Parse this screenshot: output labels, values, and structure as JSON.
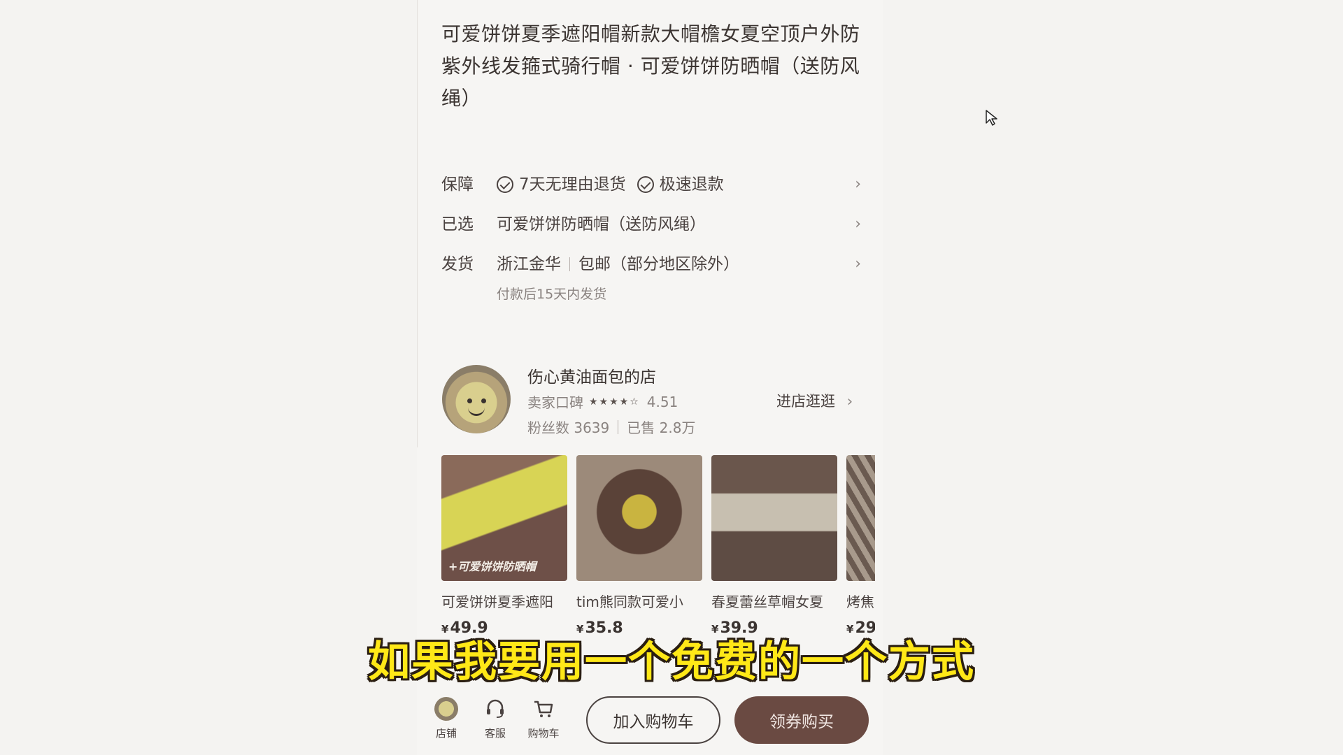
{
  "product": {
    "title": "可爱饼饼夏季遮阳帽新款大帽檐女夏空顶户外防紫外线发箍式骑行帽 · 可爱饼饼防晒帽（送防风绳）"
  },
  "info_rows": {
    "guarantee": {
      "label": "保障",
      "items": [
        "7天无理由退货",
        "极速退款"
      ]
    },
    "selected": {
      "label": "已选",
      "value": "可爱饼饼防晒帽（送防风绳）"
    },
    "shipping": {
      "label": "发货",
      "origin": "浙江金华",
      "policy": "包邮（部分地区除外）",
      "note": "付款后15天内发货"
    }
  },
  "shop": {
    "name": "伤心黄油面包的店",
    "rating_label": "卖家口碑",
    "stars": "★★★★☆",
    "rating": "4.51",
    "fans": "粉丝数 3639",
    "sold": "已售 2.8万",
    "enter": "进店逛逛"
  },
  "products": [
    {
      "name": "可爱饼饼夏季遮阳",
      "currency": "¥",
      "price": "49.9",
      "caption": "+可爱饼饼防晒帽"
    },
    {
      "name": "tim熊同款可爱小",
      "currency": "¥",
      "price": "35.8",
      "caption": ""
    },
    {
      "name": "春夏蕾丝草帽女夏",
      "currency": "¥",
      "price": "39.9",
      "caption": ""
    },
    {
      "name": "烤焦",
      "currency": "¥",
      "price": "29",
      "caption": ""
    }
  ],
  "subtitle": "如果我要用一个免费的一个方式",
  "bottom_bar": {
    "shop_tab": "店铺",
    "service_tab": "客服",
    "cart_tab": "购物车",
    "add_to_cart": "加入购物车",
    "buy_now": "领券购买"
  },
  "colors": {
    "accent": "#6a4a42",
    "subtitle": "#ffe817"
  }
}
